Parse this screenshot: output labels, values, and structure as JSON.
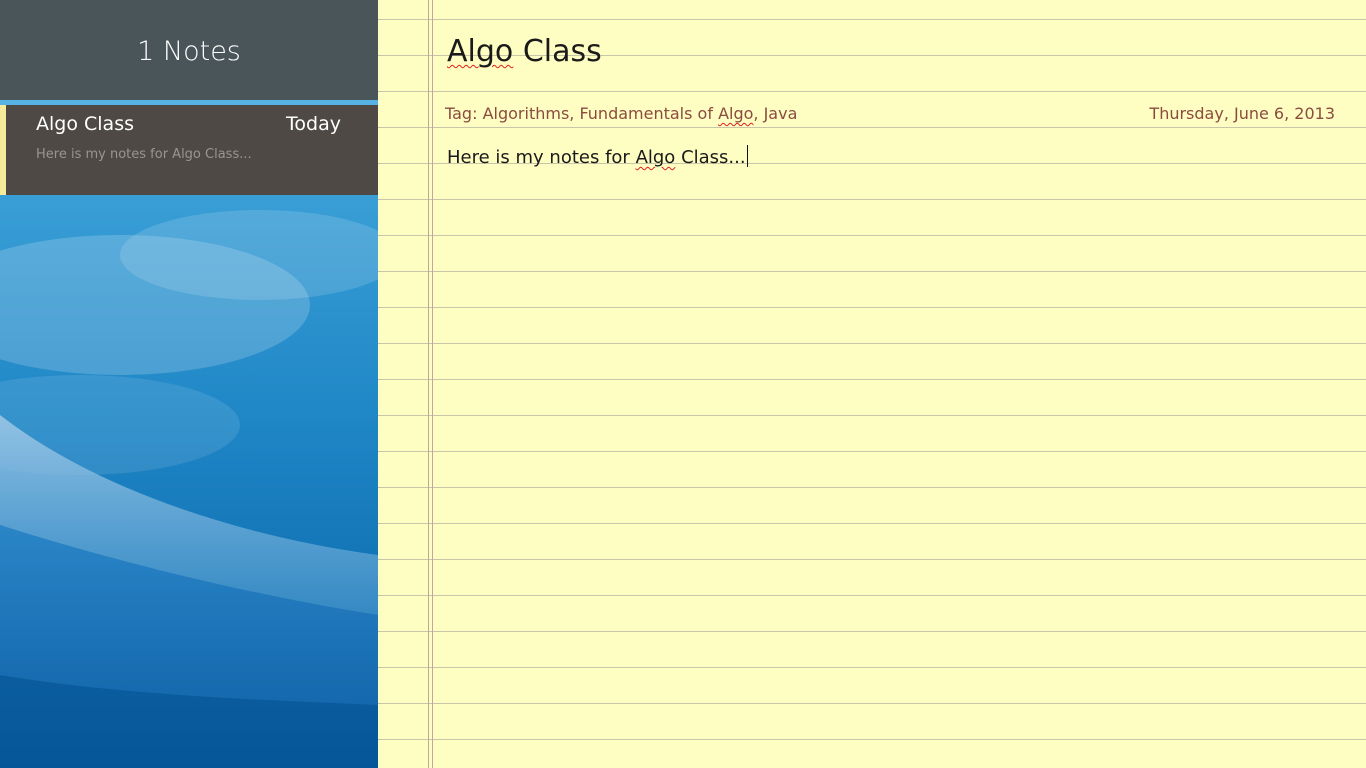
{
  "sidebar": {
    "title": "1 Notes",
    "notes": [
      {
        "title": "Algo Class",
        "date": "Today",
        "preview": "Here is my notes for Algo Class..."
      }
    ]
  },
  "editor": {
    "title_word1": "Algo",
    "title_word2": "Class",
    "tags_label": "Tag:",
    "tags": [
      "Algorithms",
      "Fundamentals of",
      "Algo",
      "Java"
    ],
    "date": "Thursday, June 6, 2013",
    "body_part1": "Here is my notes for",
    "body_part2": "Algo",
    "body_part3": "Class..."
  },
  "colors": {
    "sidebar_header": "#4a5559",
    "header_accent": "#58b3e5",
    "note_item_bg": "#4e4944",
    "note_item_marker": "#f5eb9a",
    "paper": "#fefdc2",
    "tag_text": "#8b4c40",
    "spellcheck": "#e02020"
  }
}
